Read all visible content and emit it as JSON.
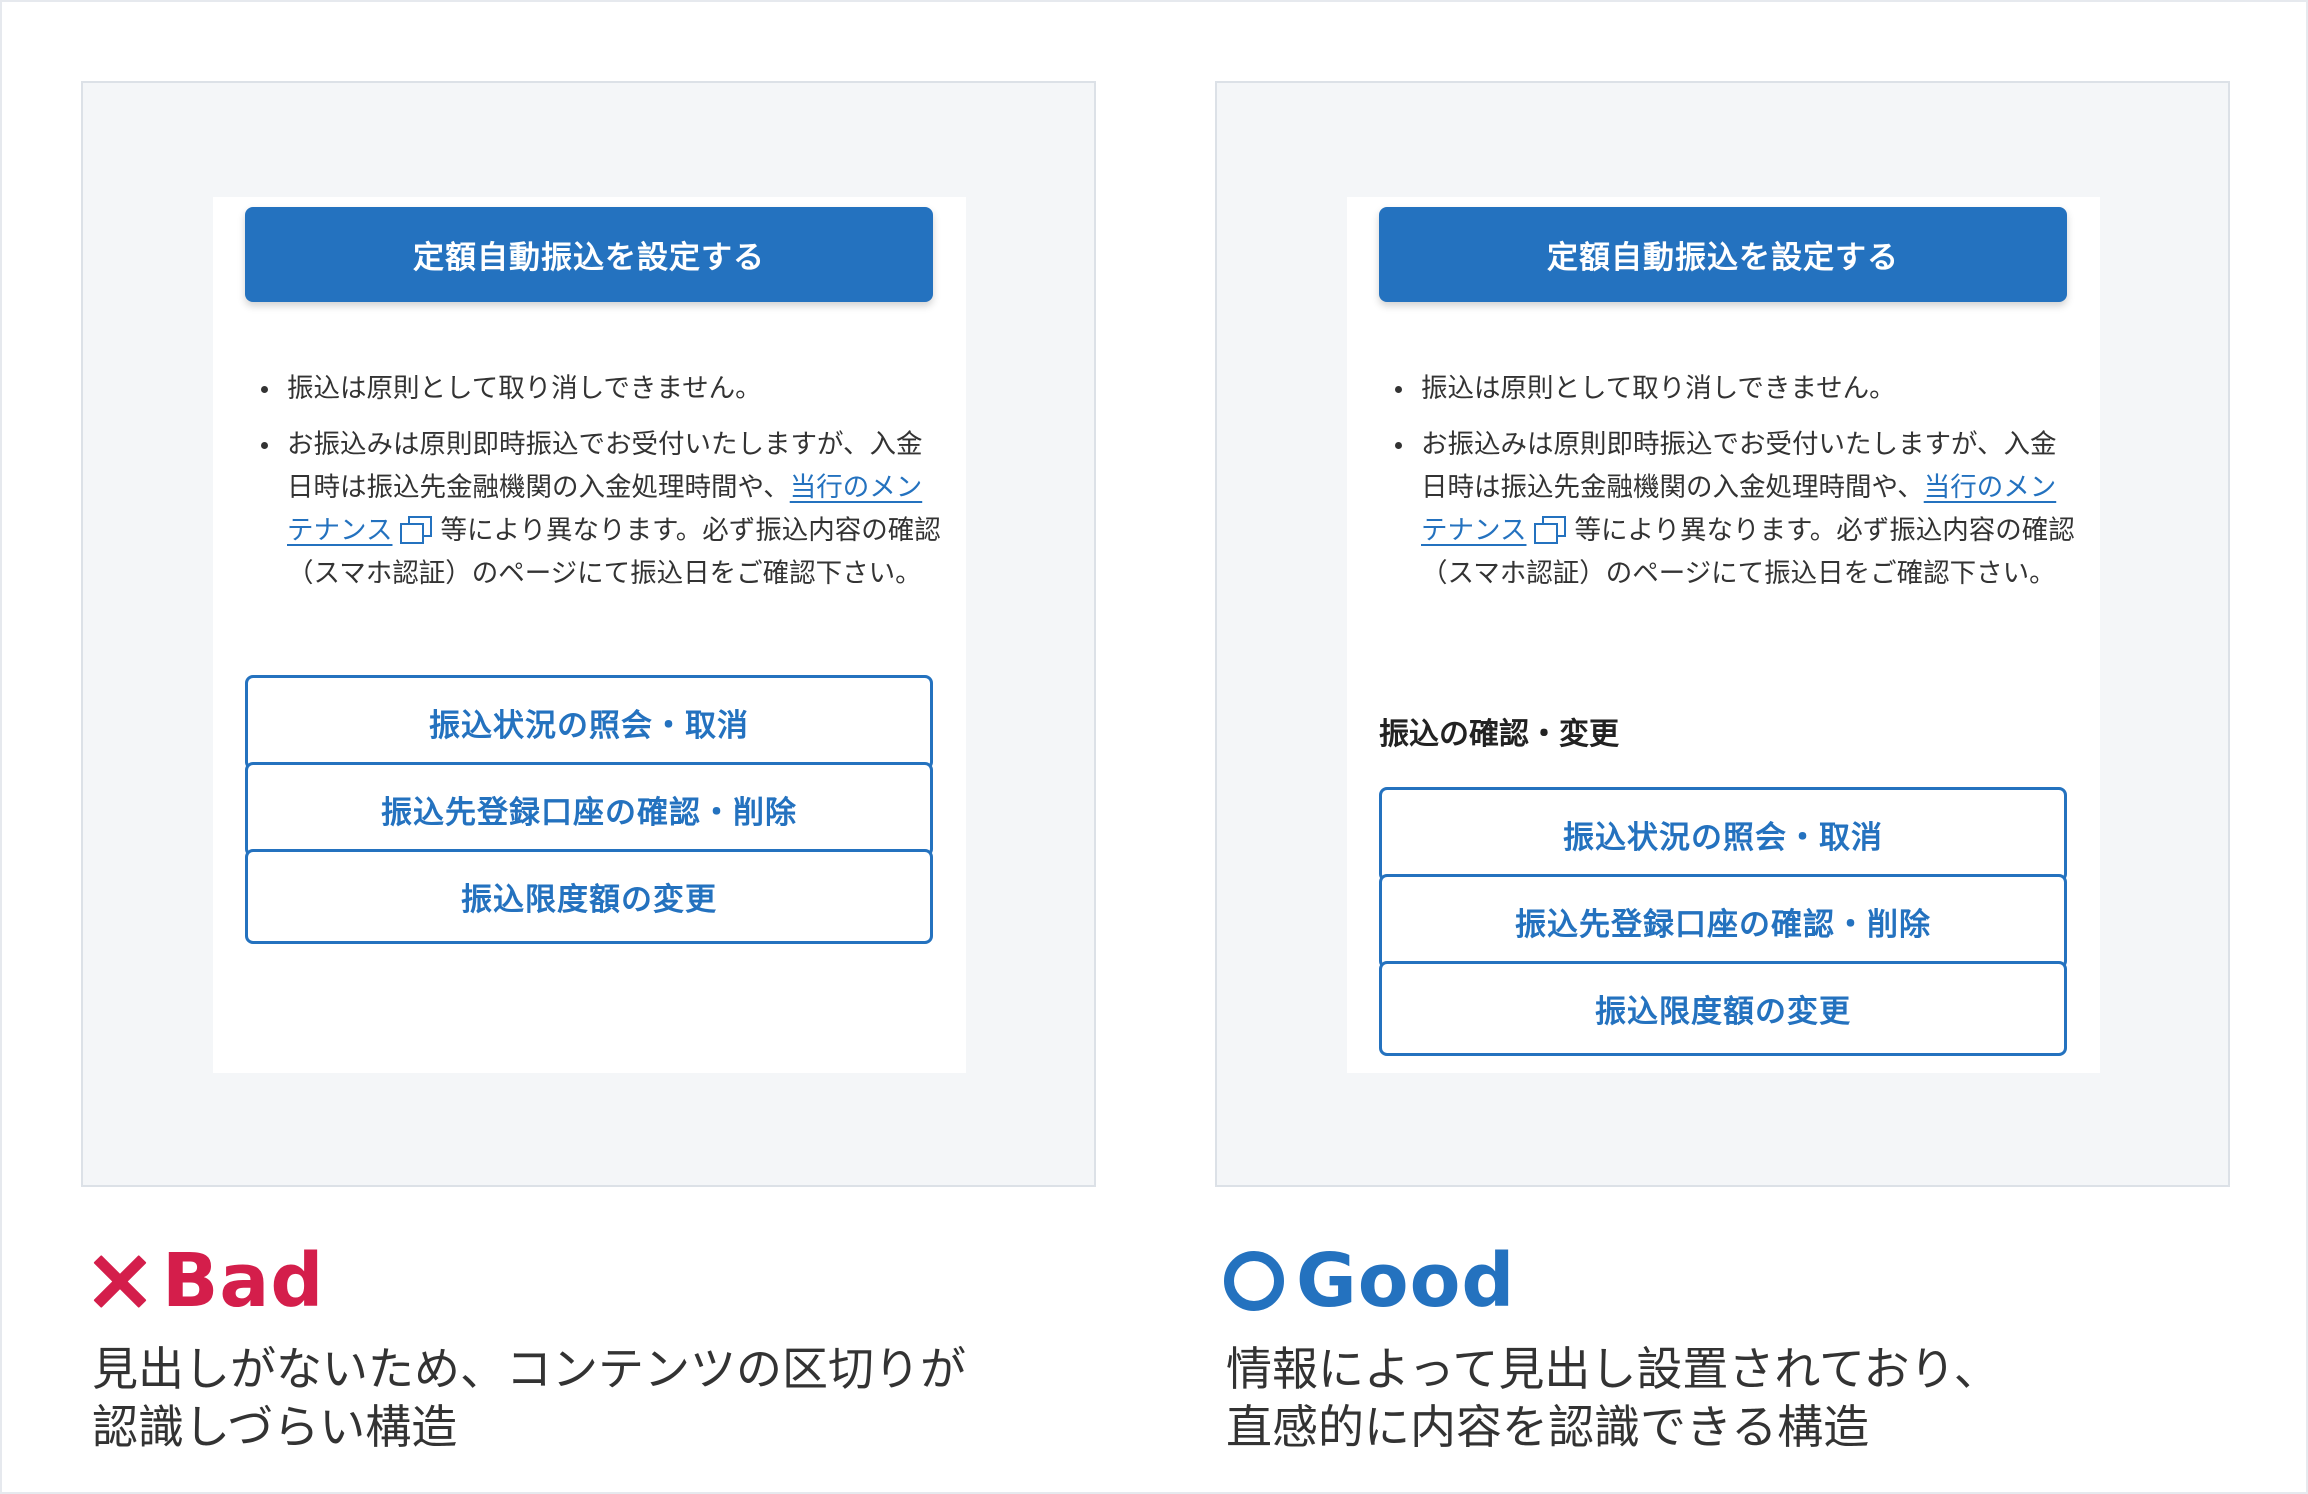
{
  "primary_button": "定額自動振込を設定する",
  "notes": {
    "item1": "振込は原則として取り消しできません。",
    "item2_before_link": "お振込みは原則即時振込でお受付いたしますが、入金日時は振込先金融機関の入金処理時間や、",
    "item2_link": "当行のメンテナンス",
    "item2_after_link": "等により異なります。必ず振込内容の確認（スマホ認証）のページにて振込日をご確認下さい。"
  },
  "section_heading": "振込の確認・変更",
  "buttons": {
    "inquiry": "振込状況の照会・取消",
    "registered_accounts": "振込先登録口座の確認・削除",
    "limit_change": "振込限度額の変更"
  },
  "bad": {
    "label": "Bad",
    "description_line1": "見出しがないため、コンテンツの区切りが",
    "description_line2": "認識しづらい構造"
  },
  "good": {
    "label": "Good",
    "description_line1": "情報によって見出し設置されており、",
    "description_line2": "直感的に内容を認識できる構造"
  },
  "icons": {
    "bad": "cross-icon",
    "good": "circle-icon",
    "external": "external-link-icon"
  },
  "colors": {
    "primary_blue": "#2472bf",
    "bad_red": "#d41e4b",
    "panel_bg": "#f4f6f8"
  }
}
